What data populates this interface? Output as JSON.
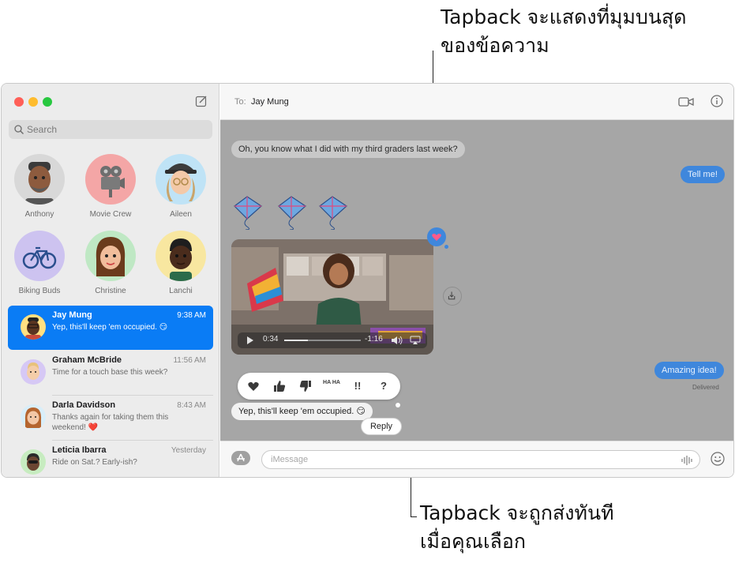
{
  "callouts": {
    "top_line1": "Tapback จะแสดงที่มุมบนสุด",
    "top_line2": "ของข้อความ",
    "bottom_line1": "Tapback จะถูกส่งทันที",
    "bottom_line2": "เมื่อคุณเลือก"
  },
  "sidebar": {
    "search_placeholder": "Search",
    "pinned": [
      {
        "label": "Anthony",
        "bg": "#d8d8d8"
      },
      {
        "label": "Movie Crew",
        "bg": "#f4a6a6"
      },
      {
        "label": "Aileen",
        "bg": "#bfe3f6"
      },
      {
        "label": "Biking Buds",
        "bg": "#cdc3f0"
      },
      {
        "label": "Christine",
        "bg": "#bfe8c4"
      },
      {
        "label": "Lanchi",
        "bg": "#f8e7a0"
      }
    ],
    "conversations": [
      {
        "name": "Jay Mung",
        "time": "9:38 AM",
        "preview": "Yep, this'll keep 'em occupied. 😏",
        "selected": true
      },
      {
        "name": "Graham McBride",
        "time": "11:56 AM",
        "preview": "Time for a touch base this week?"
      },
      {
        "name": "Darla Davidson",
        "time": "8:43 AM",
        "preview": "Thanks again for taking them this weekend! ❤️"
      },
      {
        "name": "Leticia Ibarra",
        "time": "Yesterday",
        "preview": "Ride on Sat.? Early-ish?"
      }
    ]
  },
  "header": {
    "to_label": "To:",
    "recipient": "Jay Mung"
  },
  "messages": {
    "m1": "Oh, you know what I did with my third graders last week?",
    "m2": "Tell me!",
    "m3": "Amazing idea!",
    "delivered": "Delivered",
    "m4": "Yep, this'll keep 'em occupied. 😏"
  },
  "video": {
    "elapsed": "0:34",
    "remaining": "-1:16",
    "progress": 0.31
  },
  "tapback": {
    "haha": "HA HA",
    "exclaim": "!!",
    "question": "?"
  },
  "reply_label": "Reply",
  "composer": {
    "placeholder": "iMessage"
  },
  "colors": {
    "accent": "#0a7cf5",
    "transcript_dim": "#a6a6a6"
  }
}
